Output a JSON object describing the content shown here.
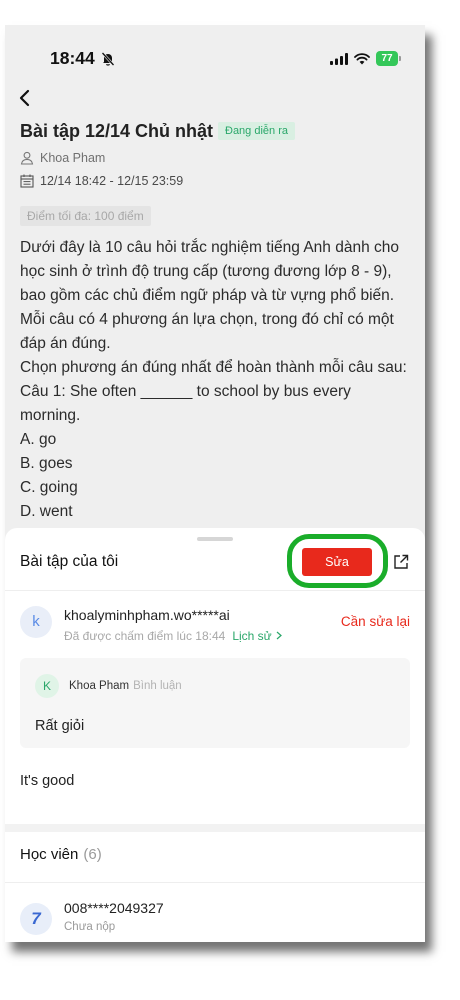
{
  "status_bar": {
    "time": "18:44",
    "battery": "77"
  },
  "assignment": {
    "title": "Bài tập 12/14 Chủ nhật",
    "status_badge": "Đang diễn ra",
    "author": "Khoa Pham",
    "schedule": "12/14 18:42 - 12/15 23:59",
    "max_score": "Điểm tối đa: 100 điểm",
    "description_lines": [
      "Dưới đây là 10 câu hỏi trắc nghiệm tiếng Anh dành cho",
      "học sinh ở trình độ trung cấp (tương đương lớp 8 - 9),",
      "bao gồm các chủ điểm ngữ pháp và từ vựng phổ biến.",
      "Mỗi câu có 4 phương án lựa chọn, trong đó chỉ có một",
      "đáp án đúng.",
      "Chọn phương án đúng nhất để hoàn thành mỗi câu sau:",
      "Câu 1: She often ______ to school by bus every",
      "morning.",
      "A. go",
      "B. goes",
      "C. going",
      "D. went"
    ]
  },
  "my_work": {
    "title": "Bài tập của tôi",
    "edit_button": "Sửa",
    "submission": {
      "avatar_letter": "k",
      "account": "khoalyminhpham.wo*****ai",
      "graded_text": "Đã được chấm điểm lúc 18:44",
      "history_link": "Lịch sử",
      "status": "Cần sửa lại"
    },
    "comment": {
      "avatar_letter": "K",
      "author": "Khoa Pham",
      "label": "Bình luận",
      "text": "Rất giỏi"
    },
    "answer_text": "It's good"
  },
  "students": {
    "label": "Học viên",
    "count": "(6)",
    "items": [
      {
        "avatar": "7",
        "id": "008****2049327",
        "status": "Chưa nộp"
      }
    ]
  },
  "icons": {
    "status_bar": [
      "bell-slash-icon",
      "signal-icon",
      "wifi-icon",
      "battery-icon"
    ],
    "back": "chevron-left-icon",
    "author": "user-icon",
    "schedule": "calendar-icon",
    "open_external": "external-link-icon",
    "history": "chevron-right-icon"
  },
  "colors": {
    "accent_green": "#2aa76a",
    "danger_red": "#e8291c",
    "highlight_green": "#1aad2a",
    "overlay_bg": "#efefef"
  }
}
